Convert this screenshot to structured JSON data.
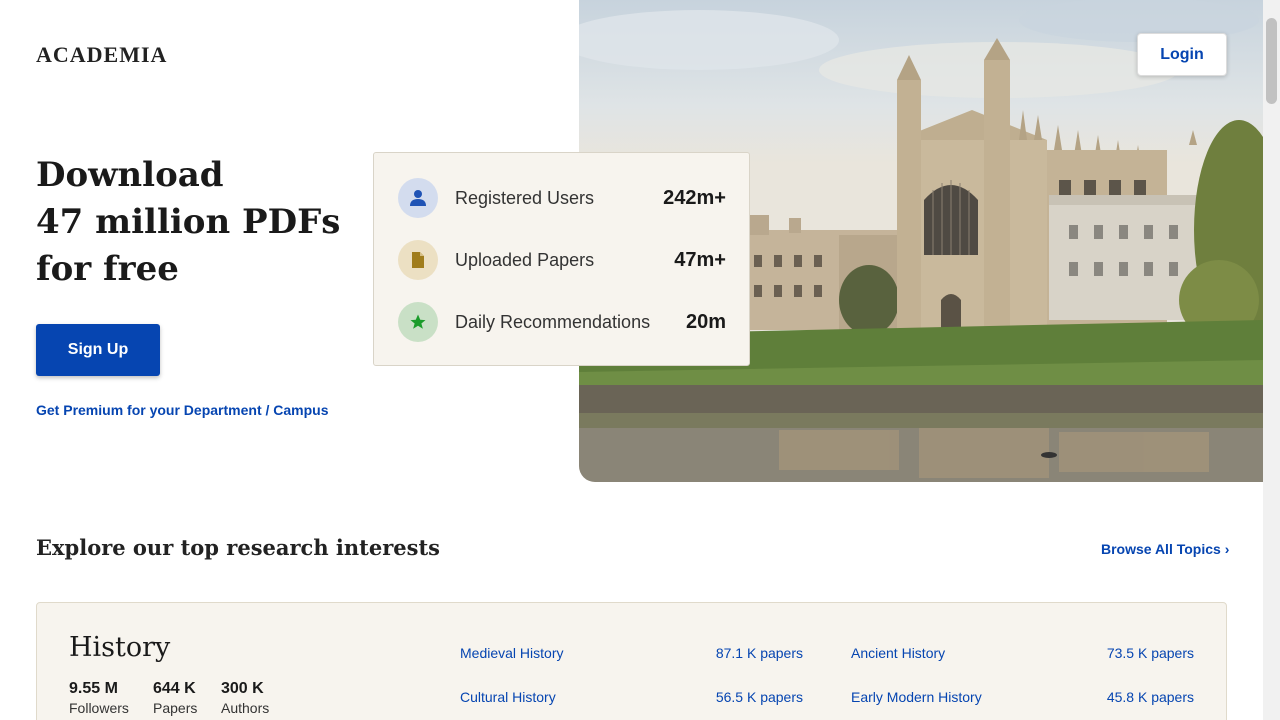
{
  "header": {
    "logo": "ACADEMIA",
    "login_label": "Login"
  },
  "hero": {
    "title_lines": [
      "Download",
      "47 million PDFs",
      "for free"
    ],
    "signup_label": "Sign Up",
    "premium_link": "Get Premium for your Department / Campus"
  },
  "stats": [
    {
      "label": "Registered Users",
      "value": "242m+",
      "icon": "user-icon",
      "color": "#1f53b5"
    },
    {
      "label": "Uploaded Papers",
      "value": "47m+",
      "icon": "document-icon",
      "color": "#a07d1c"
    },
    {
      "label": "Daily Recommendations",
      "value": "20m",
      "icon": "star-icon",
      "color": "#1b9c2b"
    }
  ],
  "explore": {
    "title": "Explore our top research interests",
    "browse_label": "Browse All Topics",
    "browse_chevron": "›"
  },
  "topic": {
    "name": "History",
    "stats": [
      {
        "value": "9.55 M",
        "label": "Followers"
      },
      {
        "value": "644 K",
        "label": "Papers"
      },
      {
        "value": "300 K",
        "label": "Authors"
      }
    ],
    "subtopics": [
      {
        "name": "Medieval History",
        "count": "87.1 K papers"
      },
      {
        "name": "Ancient History",
        "count": "73.5 K papers"
      },
      {
        "name": "Cultural History",
        "count": "56.5 K papers"
      },
      {
        "name": "Early Modern History",
        "count": "45.8 K papers"
      }
    ]
  },
  "colors": {
    "brand_blue": "#0645b1",
    "card_bg": "#f7f4ee"
  }
}
